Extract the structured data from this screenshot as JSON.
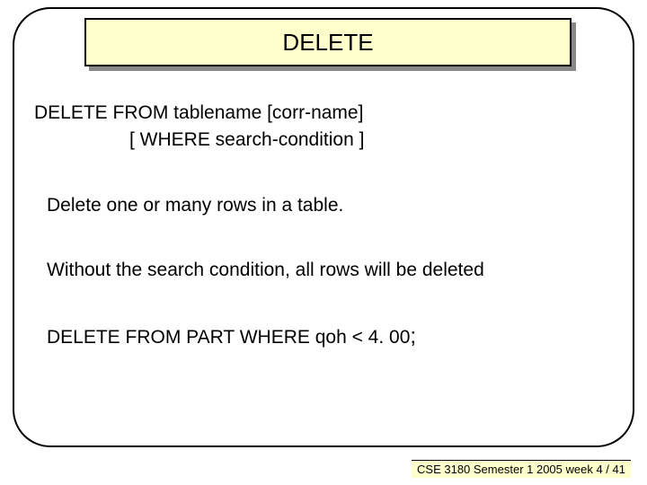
{
  "title": "DELETE",
  "syntax": {
    "line1": "DELETE FROM  tablename [corr-name]",
    "line2": "[ WHERE  search-condition ]"
  },
  "paragraphs": {
    "p1": "Delete one or many rows in a table.",
    "p2": "Without the search condition, all rows will be deleted"
  },
  "example": {
    "text": "DELETE FROM PART WHERE qoh < 4. 00",
    "terminator": ";"
  },
  "footer": "CSE 3180 Semester 1 2005  week 4 / 41"
}
